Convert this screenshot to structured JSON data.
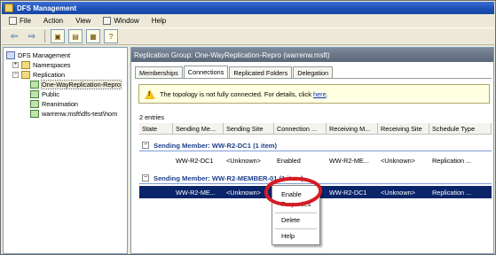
{
  "window": {
    "title": "DFS Management"
  },
  "menu": {
    "items": [
      "File",
      "Action",
      "View",
      "Window",
      "Help"
    ]
  },
  "toolbar": {
    "buttons": [
      "back-icon",
      "forward-icon",
      "up-icon",
      "show-hide-tree-icon",
      "properties-icon",
      "help-icon"
    ]
  },
  "tree": {
    "nodes": [
      {
        "label": "DFS Management",
        "icon": "dfs-root-icon"
      },
      {
        "label": "Namespaces",
        "icon": "namespaces-folder-icon"
      },
      {
        "label": "Replication",
        "icon": "replication-folder-icon"
      },
      {
        "label": "One-WayReplication-Repro",
        "icon": "replication-group-icon"
      },
      {
        "label": "Public",
        "icon": "replication-group-icon"
      },
      {
        "label": "Reanimation",
        "icon": "replication-group-icon"
      },
      {
        "label": "warrenw.msft\\dfs-test\\hom",
        "icon": "replication-group-icon"
      }
    ]
  },
  "pane": {
    "header": "Replication Group: One-WayReplication-Repro (warrenw.msft)",
    "tabs": [
      "Memberships",
      "Connections",
      "Replicated Folders",
      "Delegation"
    ],
    "active_tab": "Connections"
  },
  "info_bar": {
    "text": "The topology is not fully connected. For details, click ",
    "link": "here",
    "end": "."
  },
  "entries_count": "2 entries",
  "grid": {
    "columns": [
      "State",
      "Sending Me...",
      "Sending Site",
      "Connection ...",
      "Receiving M...",
      "Receiving Site",
      "Schedule Type"
    ],
    "groups": [
      {
        "title": "Sending Member: WW-R2-DC1 (1 item)",
        "rows": [
          [
            "",
            "WW-R2-DC1",
            "<Unknown>",
            "Enabled",
            "WW-R2-ME...",
            "<Unknown>",
            "Replication ..."
          ]
        ]
      },
      {
        "title": "Sending Member: WW-R2-MEMBER-01 (1 item)",
        "rows": [
          [
            "",
            "WW-R2-ME...",
            "<Unknown>",
            "",
            "WW-R2-DC1",
            "<Unknown>",
            "Replication ..."
          ]
        ]
      }
    ]
  },
  "context_menu": {
    "items": [
      "Enable",
      "Properties",
      "Delete",
      "Help"
    ]
  },
  "colors": {
    "selection": "#0a246a",
    "annotation": "#d61b24",
    "group_header": "#1e3f8a",
    "info_bar": "#ffffe1"
  }
}
